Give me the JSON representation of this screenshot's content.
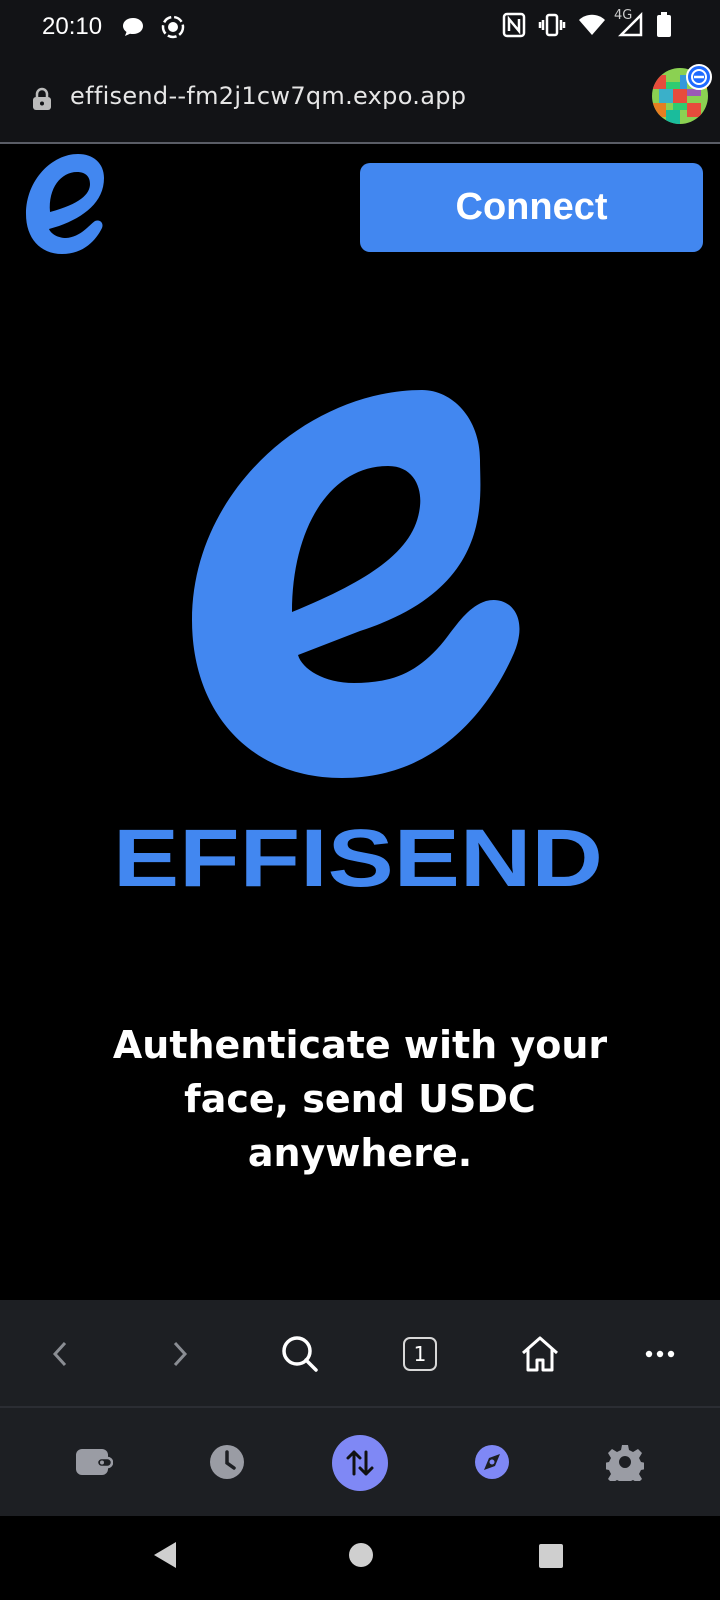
{
  "status_bar": {
    "time": "20:10",
    "network": "4G",
    "icons": [
      "chat-bubble-icon",
      "screen-record-icon",
      "nfc-icon",
      "vibrate-icon",
      "wifi-icon",
      "cellular-signal-icon",
      "battery-icon"
    ]
  },
  "browser": {
    "url": "effisend--fm2j1cw7qm.expo.app",
    "toolbar": [
      "back-icon",
      "forward-icon",
      "search-icon",
      "tabs-icon",
      "home-icon",
      "more-icon"
    ],
    "tab_count": "1"
  },
  "page": {
    "connect_label": "Connect",
    "brand_name": "EFFISEND",
    "tagline_lines": [
      "Authenticate with your",
      "face, send USDC",
      "anywhere."
    ]
  },
  "app_tabs": [
    "wallet-icon",
    "history-icon",
    "transfer-icon",
    "explore-icon",
    "settings-icon"
  ],
  "system_nav": [
    "back-triangle-icon",
    "home-circle-icon",
    "recents-square-icon"
  ],
  "colors": {
    "brand_blue": "#4287f0",
    "active_tab": "#7f88f5",
    "chrome_bg": "#1d1f23"
  }
}
